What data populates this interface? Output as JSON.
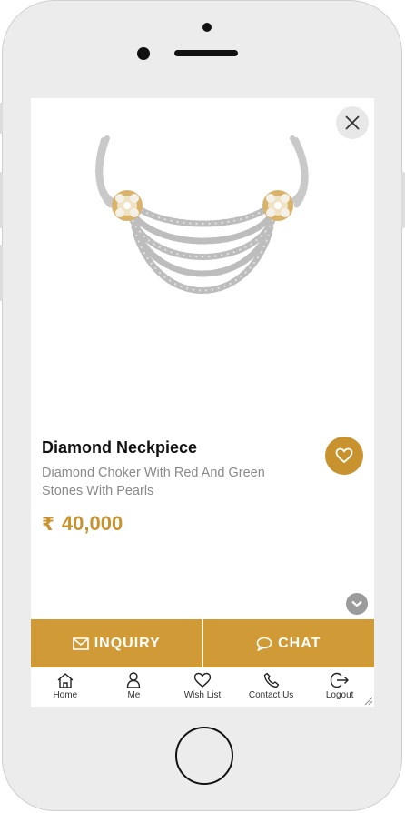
{
  "product": {
    "title": "Diamond Neckpiece",
    "description": "Diamond Choker With Red And Green Stones With Pearls",
    "currency_symbol": "₹",
    "price": "40,000"
  },
  "actions": {
    "inquiry_label": "INQUIRY",
    "chat_label": "CHAT"
  },
  "tabs": [
    {
      "label": "Home",
      "icon": "home-icon"
    },
    {
      "label": "Me",
      "icon": "user-icon"
    },
    {
      "label": "Wish List",
      "icon": "heart-icon"
    },
    {
      "label": "Contact Us",
      "icon": "phone-icon"
    },
    {
      "label": "Logout",
      "icon": "logout-icon"
    }
  ],
  "colors": {
    "accent": "#d09a36",
    "price": "#c8922f",
    "device": "#ececec"
  }
}
